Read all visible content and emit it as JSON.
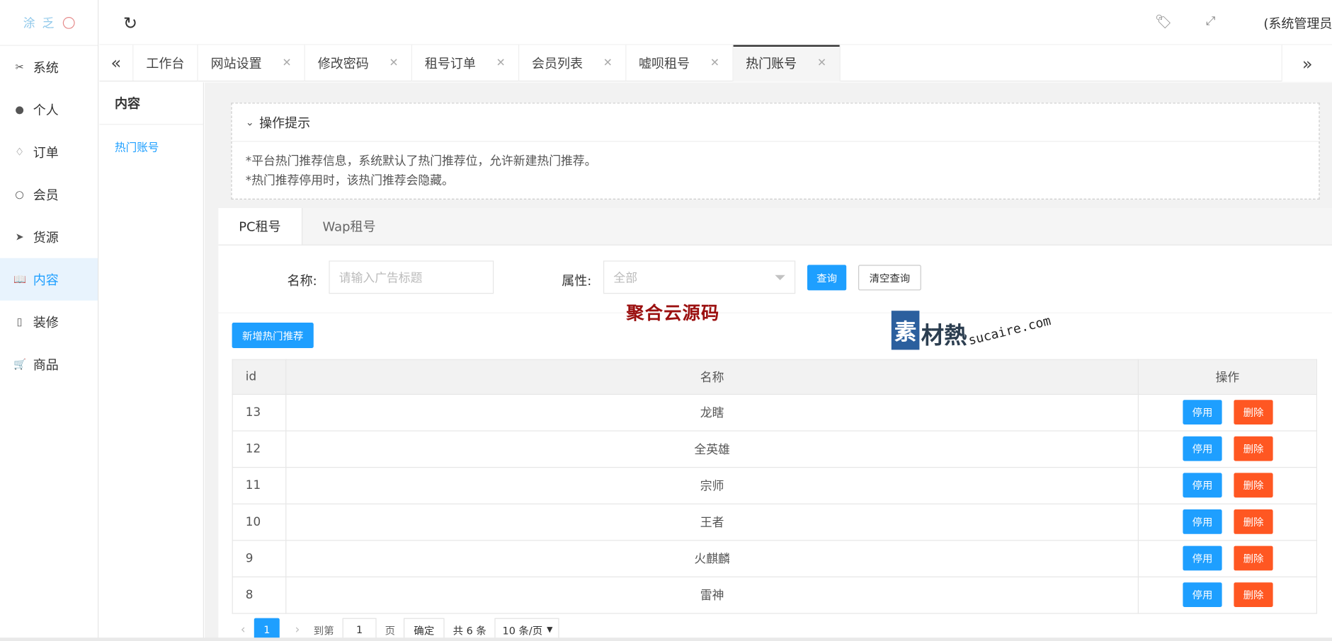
{
  "app": {
    "logo_text": "涂 乏",
    "user_label": "(系统管理员)"
  },
  "sidebar": {
    "items": [
      {
        "label": "系统",
        "icon": "tools-icon"
      },
      {
        "label": "个人",
        "icon": "user-icon"
      },
      {
        "label": "订单",
        "icon": "bell-icon"
      },
      {
        "label": "会员",
        "icon": "member-icon"
      },
      {
        "label": "货源",
        "icon": "send-icon"
      },
      {
        "label": "内容",
        "icon": "book-icon",
        "active": true
      },
      {
        "label": "装修",
        "icon": "tablet-icon"
      },
      {
        "label": "商品",
        "icon": "cart-icon"
      }
    ]
  },
  "tabs": [
    {
      "label": "工作台",
      "closable": false
    },
    {
      "label": "网站设置",
      "closable": true
    },
    {
      "label": "修改密码",
      "closable": true
    },
    {
      "label": "租号订单",
      "closable": true
    },
    {
      "label": "会员列表",
      "closable": true
    },
    {
      "label": "嘘呗租号",
      "closable": true
    },
    {
      "label": "热门账号",
      "closable": true,
      "active": true
    }
  ],
  "subnav": {
    "title": "内容",
    "item": "热门账号"
  },
  "hint": {
    "title": "操作提示",
    "lines": [
      "*平台热门推荐信息，系统默认了热门推荐位，允许新建热门推荐。",
      "*热门推荐停用时，该热门推荐会隐藏。"
    ]
  },
  "panel_tabs": [
    "PC租号",
    "Wap租号"
  ],
  "filters": {
    "name_label": "名称:",
    "name_placeholder": "请输入广告标题",
    "attr_label": "属性:",
    "attr_value": "全部",
    "search_btn": "查询",
    "clear_btn": "清空查询"
  },
  "watermarks": {
    "red": "聚合云源码",
    "blue_block": "素",
    "blue_cn": "材熱",
    "blue_en": "sucaire.com"
  },
  "add_btn": "新增热门推荐",
  "table": {
    "headers": [
      "id",
      "名称",
      "操作"
    ],
    "rows": [
      {
        "id": "13",
        "name": "龙瞎"
      },
      {
        "id": "12",
        "name": "全英雄"
      },
      {
        "id": "11",
        "name": "宗师"
      },
      {
        "id": "10",
        "name": "王者"
      },
      {
        "id": "9",
        "name": "火麒麟"
      },
      {
        "id": "8",
        "name": "雷神"
      }
    ],
    "disable_label": "停用",
    "delete_label": "删除"
  },
  "pager": {
    "current": "1",
    "goto_label": "到第",
    "goto_value": "1",
    "page_label": "页",
    "confirm": "确定",
    "total": "共 6 条",
    "per_page": "10 条/页"
  },
  "colors": {
    "primary": "#1e9fff",
    "danger": "#ff5722"
  }
}
